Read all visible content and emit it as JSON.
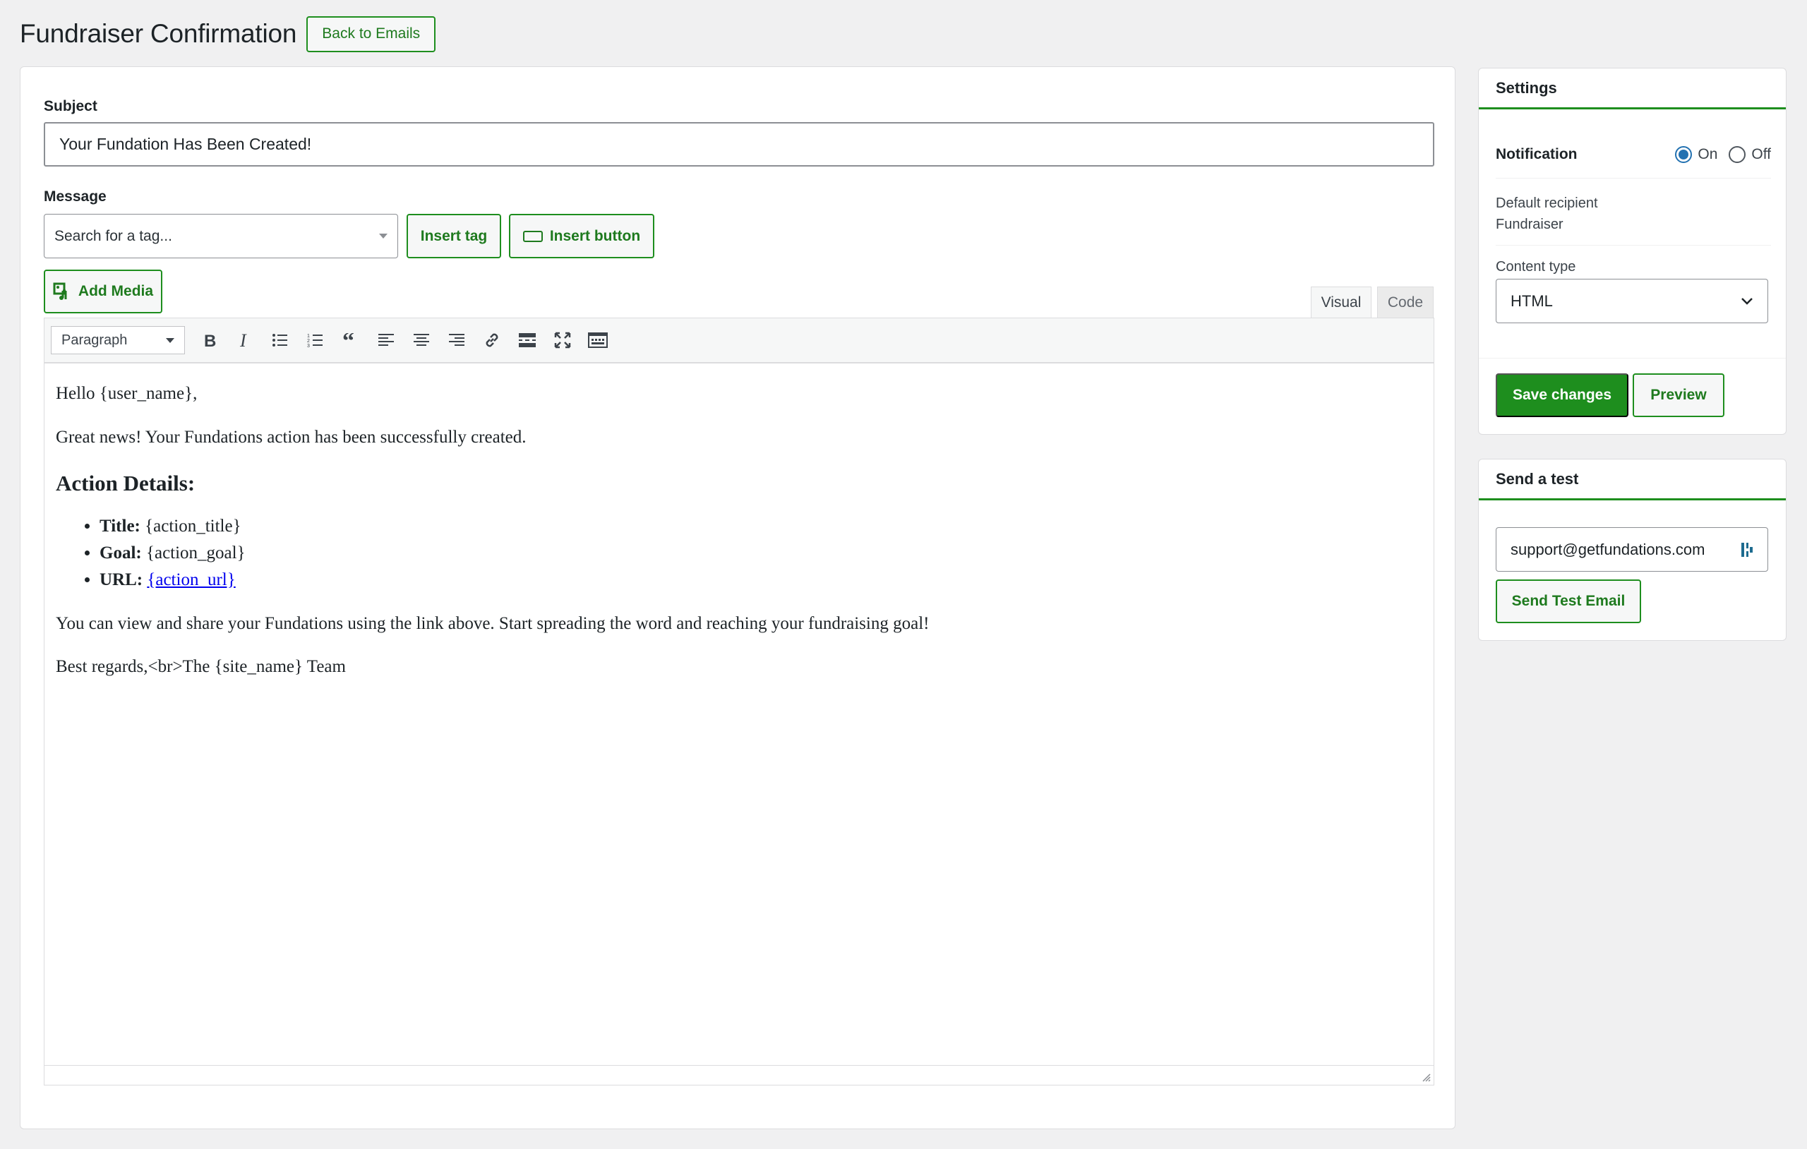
{
  "header": {
    "title": "Fundraiser Confirmation",
    "back_label": "Back to Emails"
  },
  "form": {
    "subject_label": "Subject",
    "subject_value": "Your Fundation Has Been Created!",
    "message_label": "Message",
    "tag_search_placeholder": "Search for a tag...",
    "insert_tag_label": "Insert tag",
    "insert_button_label": "Insert button",
    "add_media_label": "Add Media"
  },
  "editor": {
    "tabs": [
      {
        "label": "Visual",
        "active": true
      },
      {
        "label": "Code",
        "active": false
      }
    ],
    "format_value": "Paragraph",
    "toolbar_icons": [
      "bold-icon",
      "italic-icon",
      "bullet-list-icon",
      "numbered-list-icon",
      "blockquote-icon",
      "align-left-icon",
      "align-center-icon",
      "align-right-icon",
      "link-icon",
      "read-more-icon",
      "fullscreen-icon",
      "toolbar-toggle-icon"
    ],
    "content": {
      "greeting": "Hello {user_name},",
      "intro": "Great news! Your Fundations action has been successfully created.",
      "heading": "Action Details:",
      "details": [
        {
          "label": "Title:",
          "value": "{action_title}",
          "link": false
        },
        {
          "label": "Goal:",
          "value": "{action_goal}",
          "link": false
        },
        {
          "label": "URL:",
          "value": "{action_url}",
          "link": true
        }
      ],
      "share_text": "You can view and share your Fundations using the link above. Start spreading the word and reaching your fundraising goal!",
      "signoff": "Best regards,<br>The {site_name} Team"
    }
  },
  "settings": {
    "title": "Settings",
    "notification_label": "Notification",
    "notification_on_label": "On",
    "notification_off_label": "Off",
    "notification_value": "On",
    "recipient_label": "Default recipient",
    "recipient_value": "Fundraiser",
    "content_type_label": "Content type",
    "content_type_value": "HTML",
    "save_label": "Save changes",
    "preview_label": "Preview"
  },
  "send_test": {
    "title": "Send a test",
    "email_value": "support@getfundations.com",
    "send_label": "Send Test Email"
  },
  "colors": {
    "accent": "#1e8e1e",
    "radio_active": "#2271b1",
    "link": "#0000ee"
  }
}
